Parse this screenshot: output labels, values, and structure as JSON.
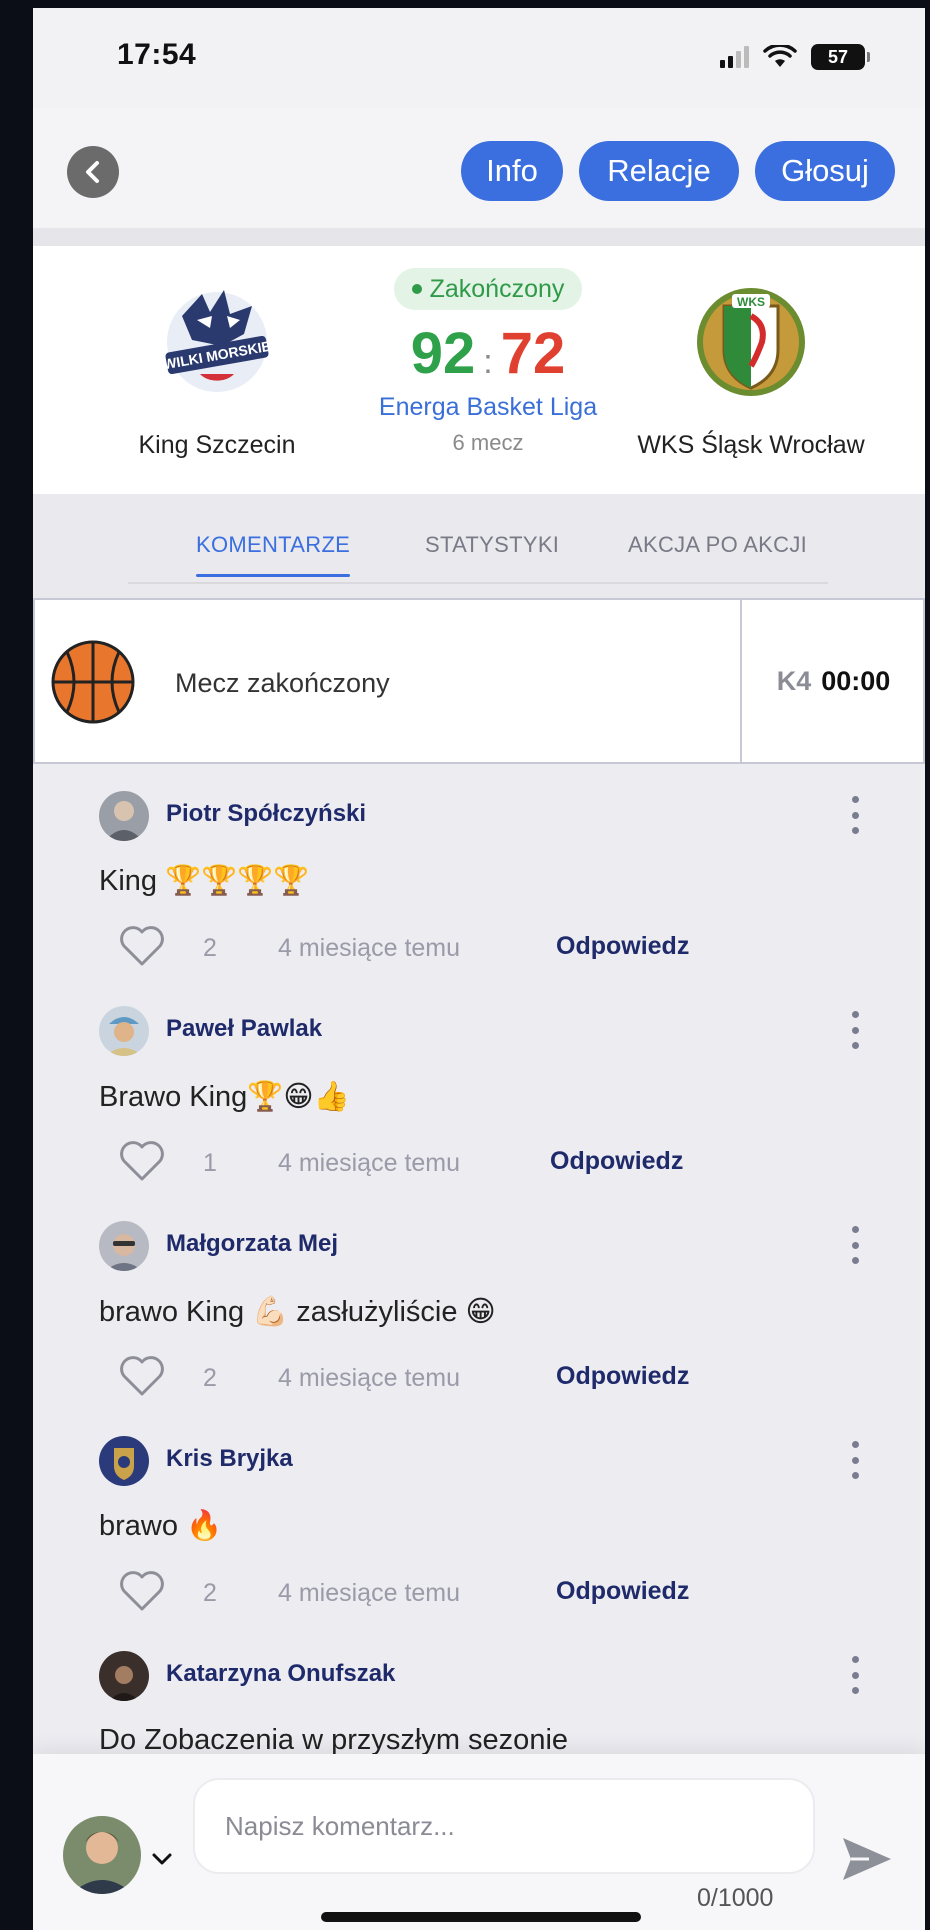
{
  "status_bar": {
    "time": "17:54",
    "battery": "57"
  },
  "header": {
    "buttons": [
      {
        "label": "Info"
      },
      {
        "label": "Relacje"
      },
      {
        "label": "Głosuj"
      }
    ]
  },
  "match": {
    "status": "Zakończony",
    "home": {
      "name": "King Szczecin",
      "score": "92",
      "logo_text": "WILKI MORSKIE"
    },
    "away": {
      "name": "WKS Śląsk Wrocław",
      "score": "72",
      "logo_text": "WKS"
    },
    "separator": ":",
    "league": "Energa Basket Liga",
    "round": "6 mecz"
  },
  "tabs": [
    {
      "label": "KOMENTARZE",
      "active": true
    },
    {
      "label": "STATYSTYKI",
      "active": false
    },
    {
      "label": "AKCJA PO AKCJI",
      "active": false
    }
  ],
  "event": {
    "text": "Mecz zakończony",
    "quarter": "K4",
    "clock": "00:00"
  },
  "comments": [
    {
      "author": "Piotr Spółczyński",
      "text": "King 🏆🏆🏆🏆",
      "likes": "2",
      "time": "4 miesiące temu",
      "reply": "Odpowiedz",
      "avatar_color": "#9a9ea6"
    },
    {
      "author": "Paweł Pawlak",
      "text": "Brawo King🏆😁👍",
      "likes": "1",
      "time": "4 miesiące temu",
      "reply": "Odpowiedz",
      "avatar_color": "#c9b79b"
    },
    {
      "author": "Małgorzata Mej",
      "text": "brawo King 💪🏻 zasłużyliście 😁",
      "likes": "2",
      "time": "4 miesiące temu",
      "reply": "Odpowiedz",
      "avatar_color": "#a7a8b0"
    },
    {
      "author": "Kris Bryjka",
      "text": "brawo 🔥",
      "likes": "2",
      "time": "4 miesiące temu",
      "reply": "Odpowiedz",
      "avatar_color": "#2a3a7a"
    },
    {
      "author": "Katarzyna Onufszak",
      "text": "Do Zobaczenia w przyszłym sezonie",
      "likes": "",
      "time": "",
      "reply": "",
      "avatar_color": "#3a2f2a"
    }
  ],
  "composer": {
    "placeholder": "Napisz komentarz...",
    "counter": "0/1000"
  },
  "colors": {
    "accent": "#3b6fe0",
    "home_score": "#2fa14a",
    "away_score": "#e0402f",
    "author": "#1f2a6b"
  }
}
